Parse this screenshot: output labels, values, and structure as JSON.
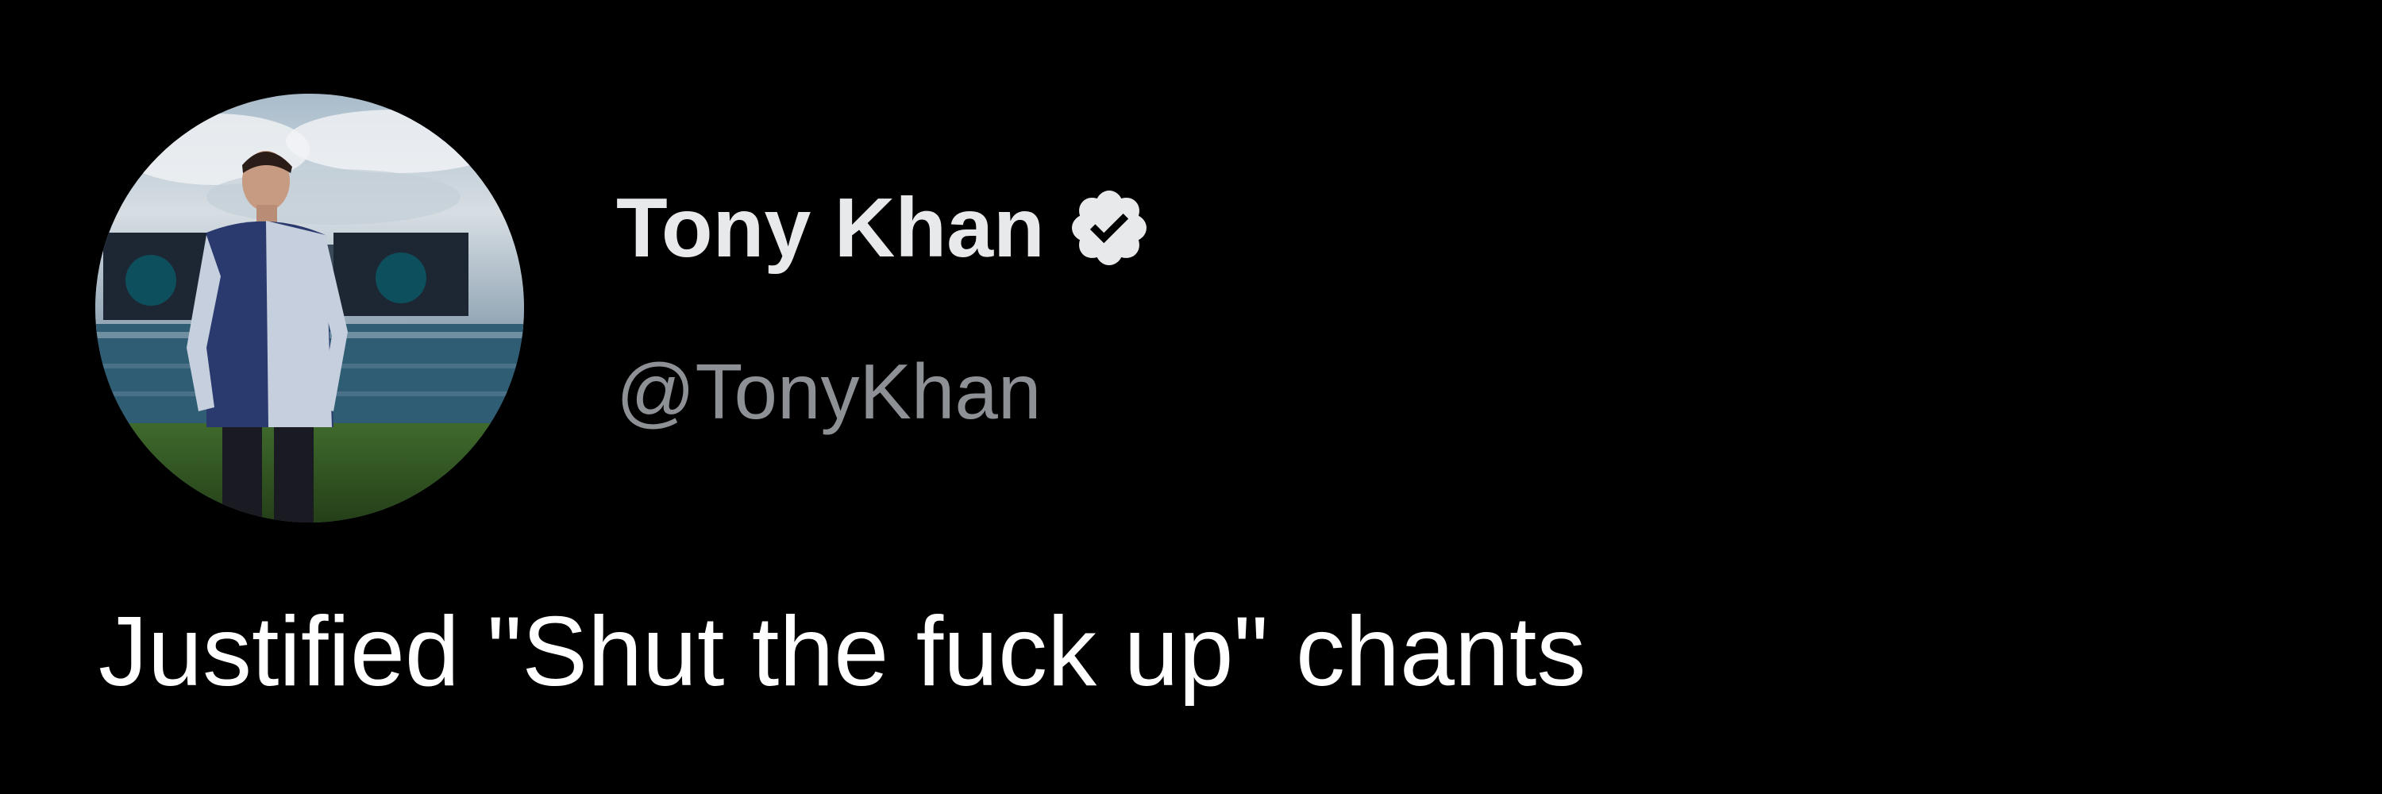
{
  "author": {
    "name": "Tony Khan",
    "handle": "@TonyKhan",
    "verified": true,
    "avatar_icon": "profile-photo",
    "verified_icon": "verified-badge-icon"
  },
  "tweet": {
    "text": "Justified \"Shut the fuck up\" chants"
  },
  "colors": {
    "background": "#000000",
    "name": "#e7e9ea",
    "handle": "#8d9196",
    "text": "#ffffff",
    "badge": "#e7e9ea"
  }
}
